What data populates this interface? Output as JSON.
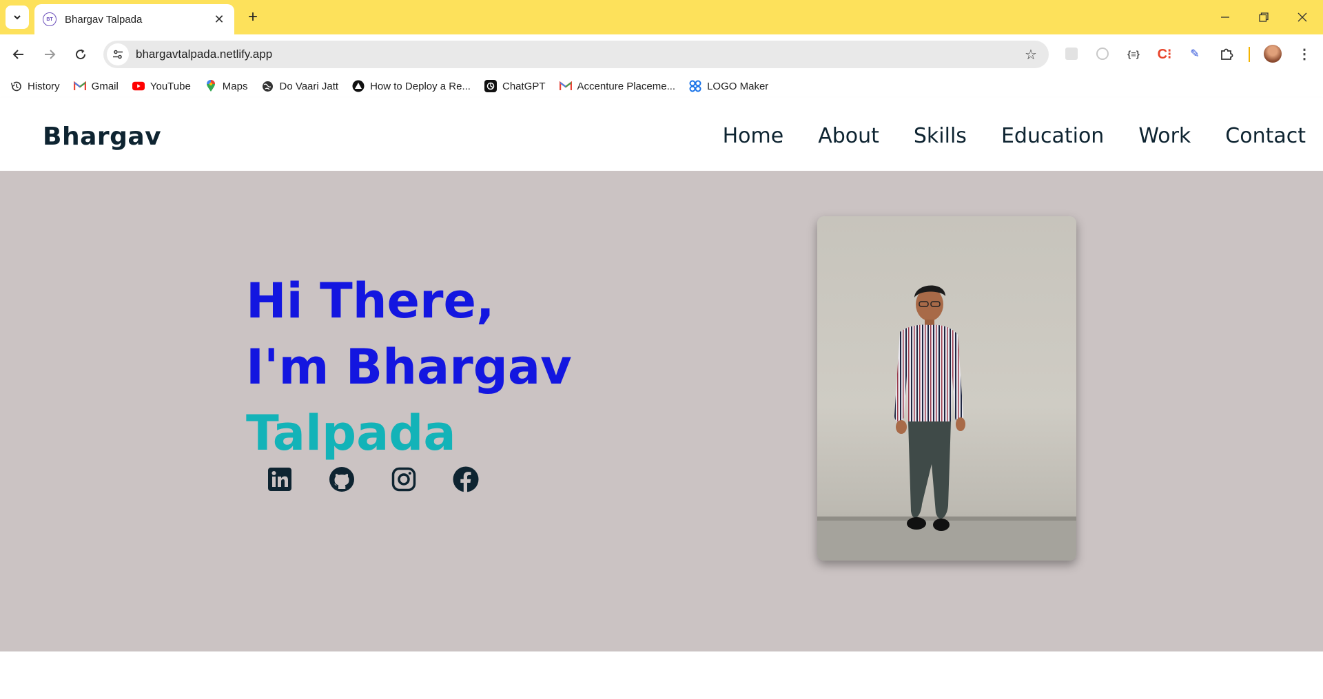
{
  "browser": {
    "tab_title": "Bhargav Talpada",
    "tab_favicon_text": "BT",
    "url": "bhargavtalpada.netlify.app",
    "bookmarks": [
      {
        "label": "History",
        "icon": "history-icon"
      },
      {
        "label": "Gmail",
        "icon": "gmail-icon"
      },
      {
        "label": "YouTube",
        "icon": "youtube-icon"
      },
      {
        "label": "Maps",
        "icon": "maps-icon"
      },
      {
        "label": "Do Vaari Jatt",
        "icon": "globe-icon"
      },
      {
        "label": "How to Deploy a Re...",
        "icon": "deploy-icon"
      },
      {
        "label": "ChatGPT",
        "icon": "chatgpt-icon"
      },
      {
        "label": "Accenture Placeme...",
        "icon": "gmail-icon"
      },
      {
        "label": "LOGO Maker",
        "icon": "logo-maker-icon"
      }
    ]
  },
  "site": {
    "brand": "Bhargav",
    "nav": [
      "Home",
      "About",
      "Skills",
      "Education",
      "Work",
      "Contact"
    ],
    "hero": {
      "line1": "Hi There,",
      "line2": "I'm Bhargav",
      "line3": "Talpada"
    },
    "socials": [
      "linkedin-icon",
      "github-icon",
      "instagram-icon",
      "facebook-icon"
    ],
    "colors": {
      "hero_bg": "#cbc3c3",
      "heading_blue": "#1316e0",
      "accent_teal": "#13b3b8",
      "text_dark": "#0e2431"
    }
  }
}
